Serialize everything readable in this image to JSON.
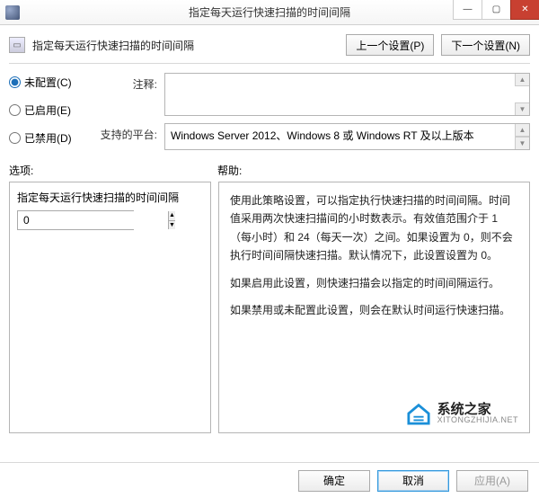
{
  "window": {
    "title": "指定每天运行快速扫描的时间间隔",
    "minimize": "—",
    "maximize": "▢",
    "close": "✕"
  },
  "header": {
    "policy_name": "指定每天运行快速扫描的时间间隔",
    "prev_btn": "上一个设置(P)",
    "next_btn": "下一个设置(N)"
  },
  "radios": {
    "not_configured": "未配置(C)",
    "enabled": "已启用(E)",
    "disabled": "已禁用(D)",
    "selected": "not_configured"
  },
  "fields": {
    "comment_label": "注释:",
    "comment_value": "",
    "platform_label": "支持的平台:",
    "platform_value": "Windows Server 2012、Windows 8 或 Windows RT 及以上版本"
  },
  "section_labels": {
    "options": "选项:",
    "help": "帮助:"
  },
  "option_panel": {
    "title": "指定每天运行快速扫描的时间间隔",
    "spin_value": "0"
  },
  "help_text": {
    "p1": "使用此策略设置，可以指定执行快速扫描的时间间隔。时间值采用两次快速扫描间的小时数表示。有效值范围介于 1（每小时）和 24（每天一次）之间。如果设置为 0，则不会执行时间间隔快速扫描。默认情况下，此设置设置为 0。",
    "p2": "如果启用此设置，则快速扫描会以指定的时间间隔运行。",
    "p3": "如果禁用或未配置此设置，则会在默认时间运行快速扫描。"
  },
  "watermark": {
    "cn": "系统之家",
    "en": "XITONGZHIJIA.NET"
  },
  "footer": {
    "ok": "确定",
    "cancel": "取消",
    "apply": "应用(A)"
  }
}
